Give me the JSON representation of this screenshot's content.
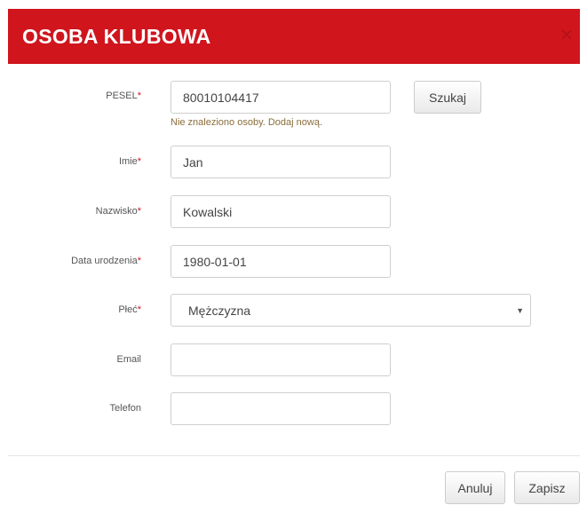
{
  "modal": {
    "title": "OSOBA KLUBOWA",
    "close_glyph": "×"
  },
  "form": {
    "pesel": {
      "label": "PESEL",
      "required_mark": "*",
      "value": "80010104417",
      "help_text": "Nie znaleziono osoby. Dodaj nową."
    },
    "search_button_label": "Szukaj",
    "first_name": {
      "label": "Imie",
      "required_mark": "*",
      "value": "Jan"
    },
    "last_name": {
      "label": "Nazwisko",
      "required_mark": "*",
      "value": "Kowalski"
    },
    "birth_date": {
      "label": "Data urodzenia",
      "required_mark": "*",
      "value": "1980-01-01"
    },
    "gender": {
      "label": "Płeć",
      "required_mark": "*",
      "selected": "Mężczyzna"
    },
    "email": {
      "label": "Email",
      "value": ""
    },
    "phone": {
      "label": "Telefon",
      "value": ""
    }
  },
  "footer": {
    "cancel_label": "Anuluj",
    "save_label": "Zapisz"
  },
  "icons": {
    "close": "close-icon",
    "caret": "caret-down-icon"
  },
  "colors": {
    "header_bg": "#d0151d",
    "required": "#d0151d",
    "help_text": "#8a6d3b"
  }
}
